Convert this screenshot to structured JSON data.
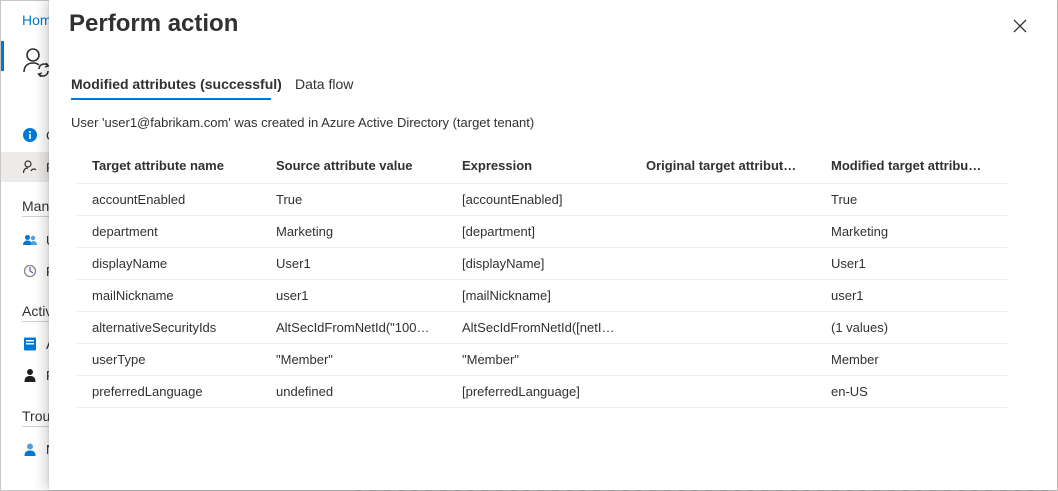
{
  "background": {
    "breadcrumb": "Hom",
    "nav_items": [
      {
        "label": "C",
        "icon": "info-icon"
      },
      {
        "label": "P",
        "icon": "user-sync-icon"
      },
      {
        "label": "U",
        "icon": "users-icon"
      },
      {
        "label": "P",
        "icon": "provisioning-icon"
      },
      {
        "label": "A",
        "icon": "audit-log-icon"
      },
      {
        "label": "P",
        "icon": "person-icon"
      },
      {
        "label": "N",
        "icon": "person-circle-icon"
      }
    ],
    "sections": [
      "Mana",
      "Activ",
      "Trou"
    ]
  },
  "panel": {
    "title": "Perform action",
    "tabs": [
      {
        "label": "Modified attributes (successful)",
        "active": true
      },
      {
        "label": "Data flow",
        "active": false
      }
    ],
    "message": "User 'user1@fabrikam.com' was created in Azure Active Directory (target tenant)",
    "table": {
      "headers": [
        "Target attribute name",
        "Source attribute value",
        "Expression",
        "Original target attribut…",
        "Modified target attribu…"
      ],
      "rows": [
        [
          "accountEnabled",
          "True",
          "[accountEnabled]",
          "",
          "True"
        ],
        [
          "department",
          "Marketing",
          "[department]",
          "",
          "Marketing"
        ],
        [
          "displayName",
          "User1",
          "[displayName]",
          "",
          "User1"
        ],
        [
          "mailNickname",
          "user1",
          "[mailNickname]",
          "",
          "user1"
        ],
        [
          "alternativeSecurityIds",
          "AltSecIdFromNetId(\"1003…",
          "AltSecIdFromNetId([netId])",
          "",
          "(1 values)"
        ],
        [
          "userType",
          "\"Member\"",
          "\"Member\"",
          "",
          "Member"
        ],
        [
          "preferredLanguage",
          "undefined",
          "[preferredLanguage]",
          "",
          "en-US"
        ]
      ]
    }
  },
  "colors": {
    "accent": "#0078d4",
    "text": "#323130",
    "divider": "#edebe9"
  }
}
